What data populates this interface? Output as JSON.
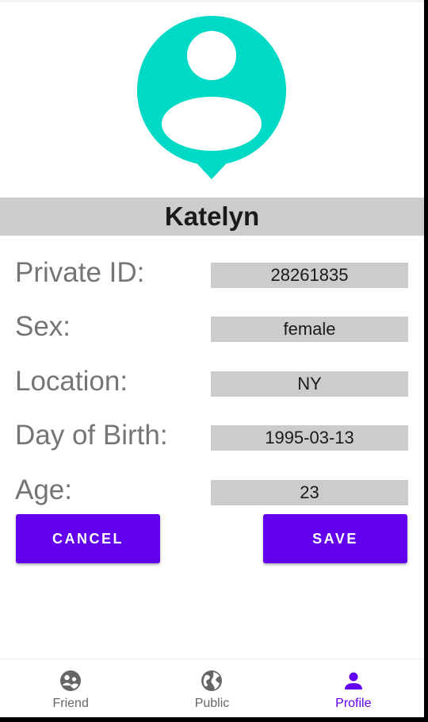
{
  "profile": {
    "name": "Katelyn",
    "avatar_icon": "user-location-pin-icon",
    "avatar_color": "#00d9c5"
  },
  "fields": [
    {
      "label": "Private ID:",
      "value": "28261835"
    },
    {
      "label": "Sex:",
      "value": "female"
    },
    {
      "label": "Location:",
      "value": "NY"
    },
    {
      "label": "Day of Birth:",
      "value": "1995-03-13"
    },
    {
      "label": "Age:",
      "value": "23"
    }
  ],
  "actions": {
    "cancel_label": "CANCEL",
    "save_label": "SAVE",
    "button_color": "#6200ee"
  },
  "nav": {
    "items": [
      {
        "label": "Friend",
        "icon": "friends-icon",
        "active": false
      },
      {
        "label": "Public",
        "icon": "globe-icon",
        "active": false
      },
      {
        "label": "Profile",
        "icon": "person-icon",
        "active": true
      }
    ],
    "active_color": "#6200ee",
    "inactive_color": "#666666"
  }
}
